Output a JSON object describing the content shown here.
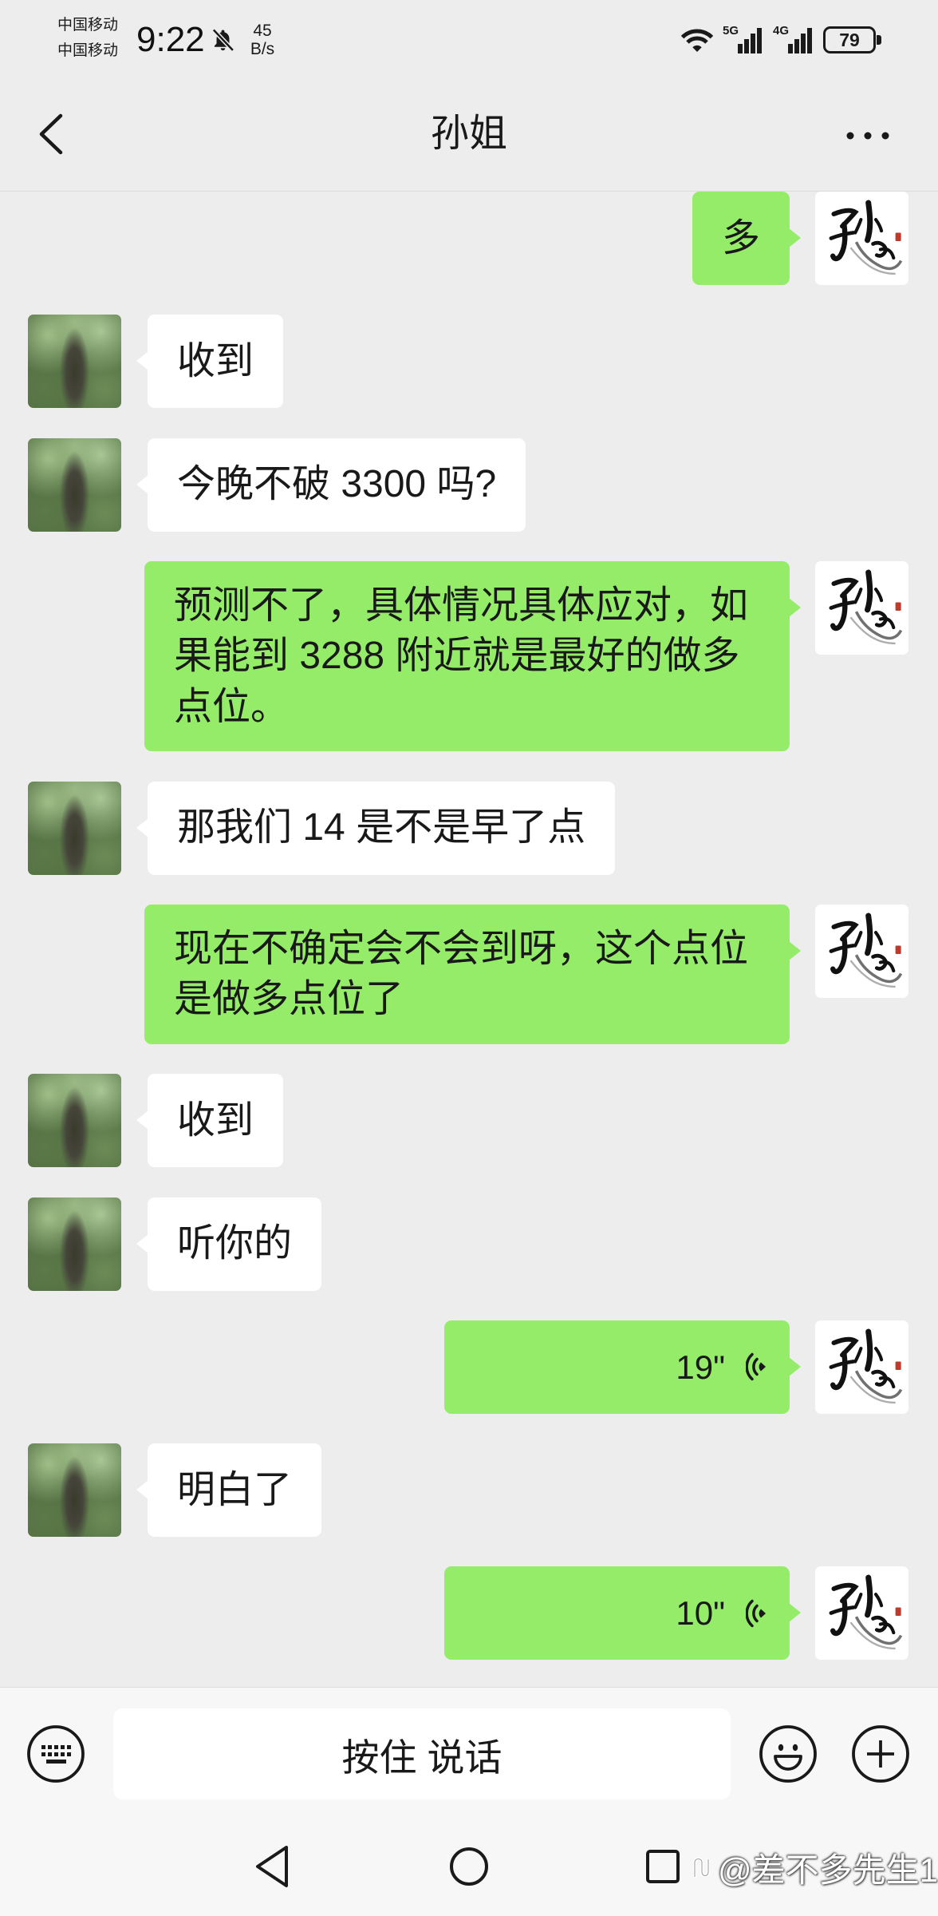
{
  "status_bar": {
    "carriers": [
      "中国移动",
      "中国移动"
    ],
    "time": "9:22",
    "mute_icon": "bell-off-icon",
    "net_speed": {
      "value": "45",
      "unit": "B/s"
    },
    "wifi_icon": "wifi-icon",
    "sim_1": {
      "network": "5G",
      "icon": "signal-bars-icon"
    },
    "sim_2": {
      "network": "4G",
      "icon": "signal-bars-icon"
    },
    "battery_level": "79"
  },
  "header": {
    "title": "孙姐",
    "back_icon": "chevron-left-icon",
    "more_icon": "more-horizontal-icon"
  },
  "messages": [
    {
      "outgoing": true,
      "text": "多"
    },
    {
      "outgoing": false,
      "text": "收到"
    },
    {
      "outgoing": false,
      "text": "今晚不破 3300 吗?"
    },
    {
      "outgoing": true,
      "text": "预测不了，具体情况具体应对，如果能到 3288 附近就是最好的做多点位。"
    },
    {
      "outgoing": false,
      "text": "那我们 14 是不是早了点"
    },
    {
      "outgoing": true,
      "text": "现在不确定会不会到呀，这个点位是做多点位了"
    },
    {
      "outgoing": false,
      "text": "收到"
    },
    {
      "outgoing": false,
      "text": "听你的"
    },
    {
      "outgoing": true,
      "voice_duration": "19\""
    },
    {
      "outgoing": false,
      "text": "明白了"
    },
    {
      "outgoing": true,
      "voice_duration": "10\""
    }
  ],
  "input_bar": {
    "hold_to_talk_label": "按住 说话",
    "keyboard_icon": "keyboard-icon",
    "emoji_icon": "smiley-icon",
    "more_icon": "plus-circle-icon"
  },
  "nav_bar": {
    "back_icon": "triangle-back-icon",
    "home_icon": "circle-home-icon",
    "recents_icon": "square-recents-icon"
  },
  "watermark": "@差不多先生1",
  "colors": {
    "chat_background": "#ededed",
    "outgoing_bubble": "#95ec69",
    "incoming_bubble": "#ffffff",
    "input_bar_background": "#f7f7f7"
  }
}
